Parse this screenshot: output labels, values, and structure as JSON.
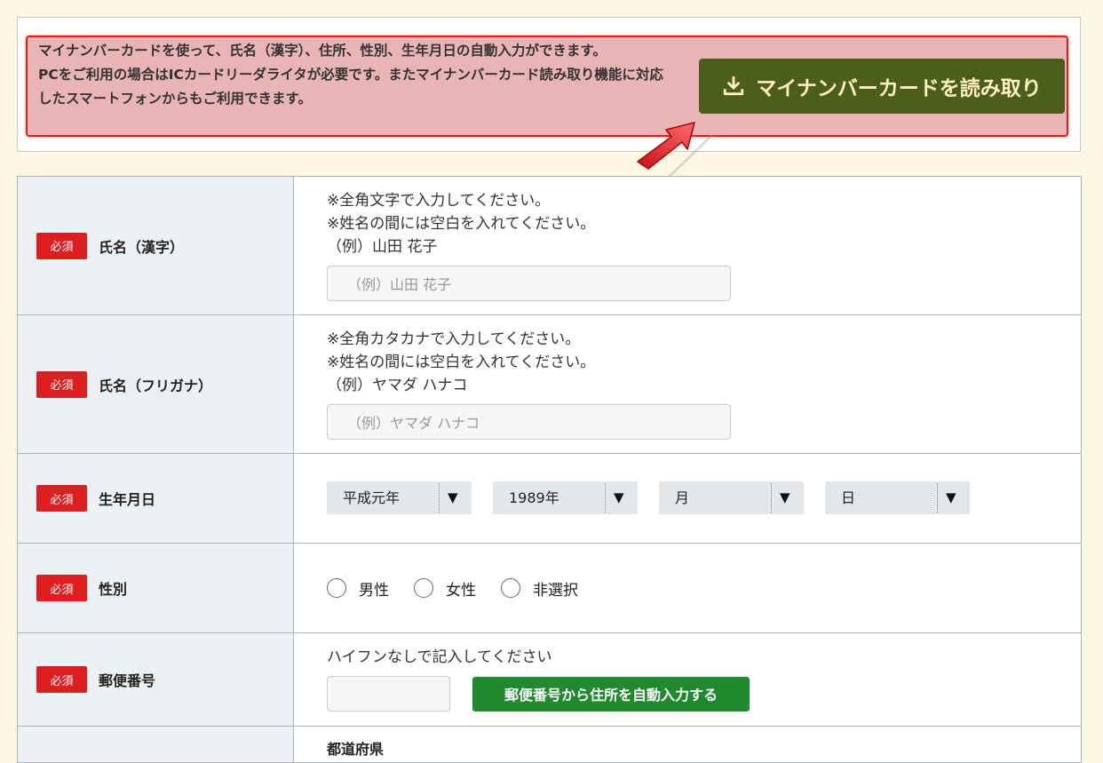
{
  "notice": {
    "line1": "マイナンバーカードを使って、氏名（漢字）、住所、性別、生年月日の自動入力ができます。",
    "line2": "PCをご利用の場合はICカードリーダライタが必要です。またマイナンバーカード読み取り機能に対応したスマートフォンからもご利用できます。",
    "button_label": "マイナンバーカードを読み取り"
  },
  "required_badge": "必須",
  "fields": {
    "name_kanji": {
      "label": "氏名（漢字）",
      "hint1": "※全角文字で入力してください。",
      "hint2": "※姓名の間には空白を入れてください。",
      "hint3": "（例）山田 花子",
      "placeholder": "（例）山田 花子"
    },
    "name_kana": {
      "label": "氏名（フリガナ）",
      "hint1": "※全角カタカナで入力してください。",
      "hint2": "※姓名の間には空白を入れてください。",
      "hint3": "（例）ヤマダ ハナコ",
      "placeholder": "（例）ヤマダ ハナコ"
    },
    "birthdate": {
      "label": "生年月日",
      "era_value": "平成元年",
      "year_value": "1989年",
      "month_value": "月",
      "day_value": "日"
    },
    "gender": {
      "label": "性別",
      "options": [
        "男性",
        "女性",
        "非選択"
      ]
    },
    "postal": {
      "label": "郵便番号",
      "hint": "ハイフンなしで記入してください",
      "button_label": "郵便番号から住所を自動入力する"
    },
    "prefecture": {
      "label": "都道府県"
    }
  },
  "colors": {
    "required_badge": "#df1f1f",
    "read_button": "#4b5e1a",
    "zip_button": "#1f8a2e",
    "background": "#fdf8e3"
  }
}
